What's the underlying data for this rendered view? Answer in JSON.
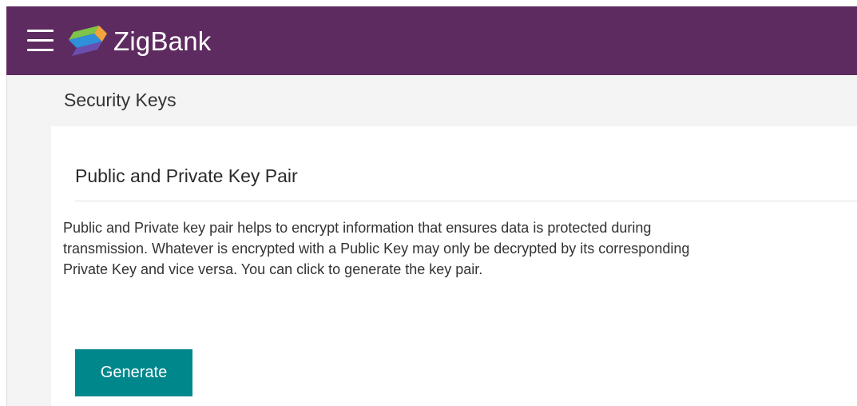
{
  "header": {
    "menu_icon": "hamburger-icon",
    "logo_icon": "zigbank-logo-icon",
    "brand_name": "ZigBank",
    "brand_color": "#5e2b60"
  },
  "page": {
    "title": "Security Keys"
  },
  "card": {
    "title": "Public and Private Key Pair",
    "description_lines": [
      "Public and Private key pair helps to encrypt information that ensures data is protected during",
      "transmission. Whatever is encrypted with a Public Key may only be decrypted by its corresponding",
      "Private Key and vice versa. You can click to generate the key pair."
    ],
    "generate_label": "Generate",
    "button_color": "#00878c"
  }
}
